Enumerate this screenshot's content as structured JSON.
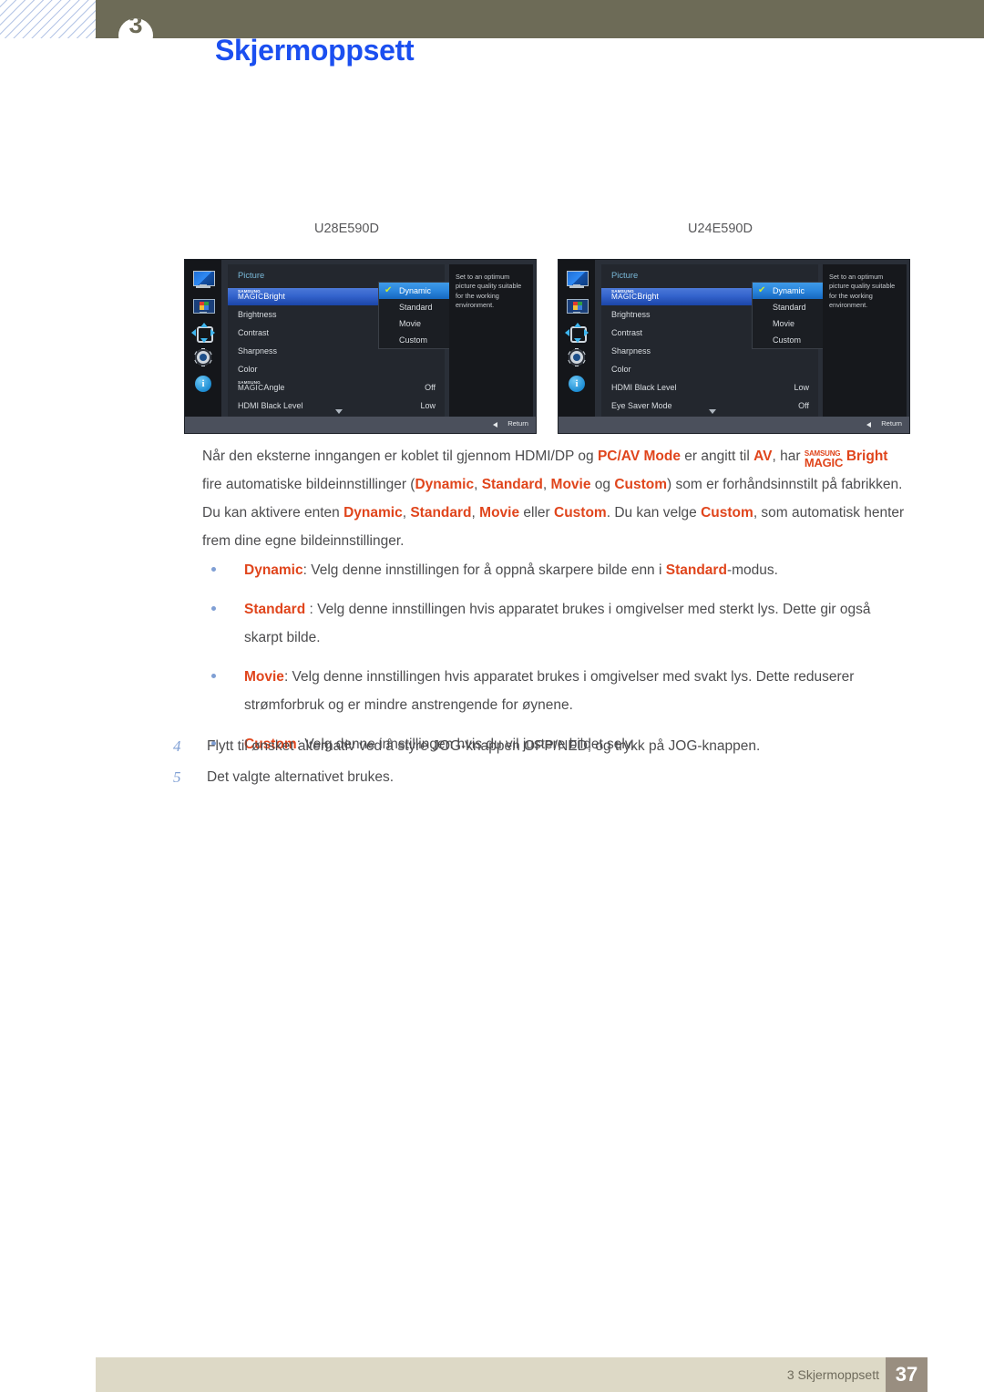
{
  "header": {
    "badge_number": "3",
    "title": "Skjermoppsett"
  },
  "figures": {
    "left_label": "U28E590D",
    "right_label": "U24E590D"
  },
  "osd": {
    "section_title": "Picture",
    "icons": [
      "monitor-icon",
      "picture-icon",
      "dpad-icon",
      "gear-icon",
      "info-icon"
    ],
    "tip_text": "Set to an optimum picture quality suitable for the working environment.",
    "return_label": "Return",
    "dropdown": {
      "items": [
        {
          "label": "Dynamic",
          "selected": true
        },
        {
          "label": "Standard",
          "selected": false
        },
        {
          "label": "Movie",
          "selected": false
        },
        {
          "label": "Custom",
          "selected": false
        }
      ],
      "check_glyph": "✔"
    },
    "left": {
      "rows": [
        {
          "sup": "SAMSUNG",
          "main": "MAGIC",
          "label": "Bright",
          "value": "",
          "selected": true
        },
        {
          "label": "Brightness",
          "value": "",
          "selected": false
        },
        {
          "label": "Contrast",
          "value": "",
          "selected": false
        },
        {
          "label": "Sharpness",
          "value": "",
          "selected": false
        },
        {
          "label": "Color",
          "value": "",
          "selected": false
        },
        {
          "sup": "SAMSUNG",
          "main": "MAGIC",
          "label": "Angle",
          "value": "Off",
          "selected": false
        },
        {
          "label": "HDMI Black Level",
          "value": "Low",
          "selected": false
        }
      ]
    },
    "right": {
      "rows": [
        {
          "sup": "SAMSUNG",
          "main": "MAGIC",
          "label": "Bright",
          "value": "",
          "selected": true
        },
        {
          "label": "Brightness",
          "value": "",
          "selected": false
        },
        {
          "label": "Contrast",
          "value": "",
          "selected": false
        },
        {
          "label": "Sharpness",
          "value": "",
          "selected": false
        },
        {
          "label": "Color",
          "value": "",
          "selected": false
        },
        {
          "label": "HDMI Black Level",
          "value": "Low",
          "selected": false
        },
        {
          "label": "Eye Saver Mode",
          "value": "Off",
          "selected": false
        }
      ]
    }
  },
  "body": {
    "paragraph": {
      "p1": "Når den eksterne inngangen er koblet til gjennom HDMI/DP og ",
      "hl1": "PC/AV Mode",
      "p2": " er angitt til ",
      "hl2": "AV",
      "p3": ", har ",
      "magic_sup": "SAMSUNG",
      "magic_main": "MAGIC",
      "hl3": "Bright",
      "p4": " fire automatiske bildeinnstillinger (",
      "hl4": "Dynamic",
      "p5": ", ",
      "hl5": "Standard",
      "p6": ", ",
      "hl6": "Movie",
      "p7": " og ",
      "hl7": "Custom",
      "p8": ") som er forhåndsinnstilt på fabrikken. Du kan aktivere enten ",
      "hl8": "Dynamic",
      "p9": ", ",
      "hl9": "Standard",
      "p10": ", ",
      "hl10": "Movie",
      "p11": " eller ",
      "hl11": "Custom",
      "p12": ". Du kan velge ",
      "hl12": "Custom",
      "p13": ", som automatisk henter frem dine egne bildeinnstillinger."
    },
    "bullets": [
      {
        "term": "Dynamic",
        "text_a": ": Velg denne innstillingen for å oppnå skarpere bilde enn i ",
        "term2": "Standard",
        "text_b": "-modus."
      },
      {
        "term": "Standard",
        "text_a": " : Velg denne innstillingen hvis apparatet brukes i omgivelser med sterkt lys. Dette gir også skarpt bilde.",
        "term2": "",
        "text_b": ""
      },
      {
        "term": "Movie",
        "text_a": ": Velg denne innstillingen hvis apparatet brukes i omgivelser med svakt lys. Dette reduserer strømforbruk og er mindre anstrengende for øynene.",
        "term2": "",
        "text_b": ""
      },
      {
        "term": "Custom",
        "text_a": ": Velg denne innstillingen hvis du vil justere bildet selv.",
        "term2": "",
        "text_b": ""
      }
    ],
    "steps": [
      {
        "num": "4",
        "text": "Flytt til ønsket alternativ ved å styre JOG-knappen OPP/NED, og trykk på JOG-knappen."
      },
      {
        "num": "5",
        "text": "Det valgte alternativet brukes."
      }
    ]
  },
  "footer": {
    "chapter": "3 Skjermoppsett",
    "page": "37"
  },
  "colors": {
    "header_bar": "#6d6b57",
    "title_blue": "#1b4ff0",
    "accent_orange": "#e0451c",
    "footer_band": "#ddd9c6",
    "page_box": "#998e80",
    "step_number": "#7f9fd4"
  }
}
